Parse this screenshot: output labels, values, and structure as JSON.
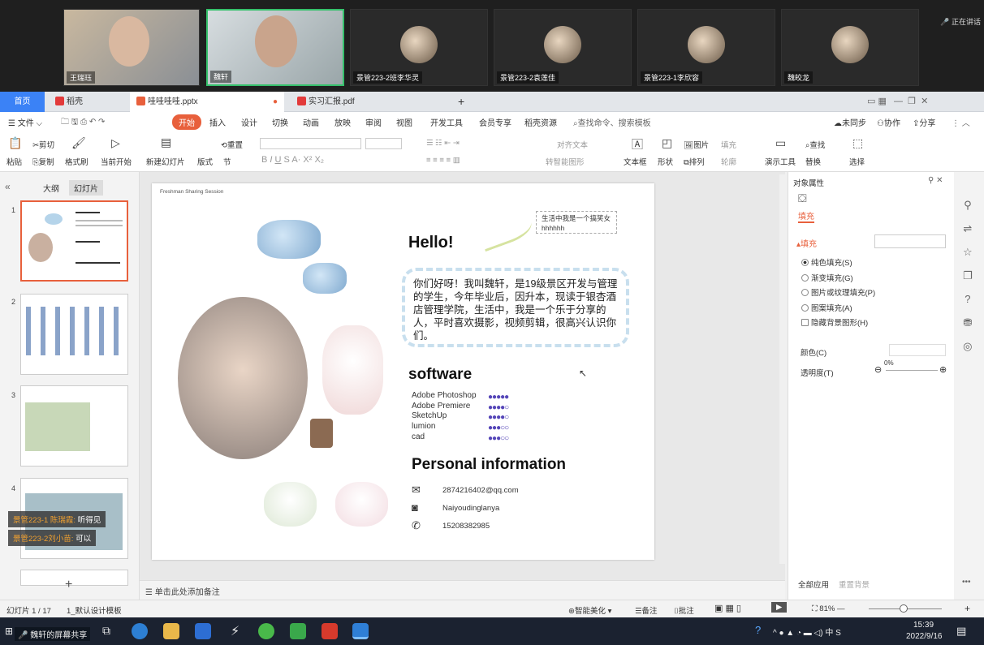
{
  "video": {
    "participants": [
      "王瑞珏",
      "魏轩",
      "景管223-2班李华灵",
      "景管223-2袁莲佳",
      "景管223-1李欣容",
      "魏皎龙"
    ],
    "speaking": "正在讲话"
  },
  "tabs": {
    "home": "首页",
    "daoke": "稻壳",
    "pptx": "哇哇哇哇.pptx",
    "pdf": "实习汇报.pdf",
    "add": "+"
  },
  "menu": {
    "file": "文件",
    "start": "开始",
    "insert": "插入",
    "design": "设计",
    "switch": "切换",
    "animation": "动画",
    "show": "放映",
    "review": "审阅",
    "view": "视图",
    "dev": "开发工具",
    "member": "会员专享",
    "resources": "稻壳资源",
    "search": "查找命令、搜索模板",
    "sync": "未同步",
    "collab": "协作",
    "share": "分享"
  },
  "ribbon": {
    "cut": "剪切",
    "copy": "复制",
    "format_brush": "格式刷",
    "paste": "粘贴",
    "from_current": "当前开始",
    "new_slide": "新建幻灯片",
    "layout": "版式",
    "section": "节",
    "reset": "重置",
    "textbox": "文本框",
    "shape": "形状",
    "picture": "图片",
    "fill": "填充",
    "arrange": "排列",
    "outline": "轮廓",
    "present_tool": "演示工具",
    "find": "查找",
    "replace": "替换",
    "select": "选择",
    "align_text": "对齐文本",
    "smart_shape": "转智能图形"
  },
  "left": {
    "outline_tab": "大纲",
    "slides_tab": "幻灯片",
    "nums": [
      "1",
      "2",
      "3",
      "4"
    ],
    "add": "+"
  },
  "chat": [
    {
      "name": "景管223-1 陈瑞霞:",
      "msg": "听得见"
    },
    {
      "name": "景管223-2刘小苗:",
      "msg": "可以"
    }
  ],
  "slide": {
    "header": "Freshman Sharing Session",
    "note": "生活中我是一个搞笑女 hhhhhh",
    "hello": "Hello!",
    "intro": "你们好呀！我叫魏轩，是19级景区开发与管理的学生，今年毕业后，因升本，现读于银杏酒店管理学院，生活中，我是一个乐于分享的人，平时喜欢摄影，视频剪辑，很高兴认识你们。",
    "software_title": "software",
    "software": [
      "Adobe Photoshop",
      "Adobe Premiere",
      "SketchUp",
      "lumion",
      "cad"
    ],
    "software_levels": [
      5,
      4,
      4,
      3,
      3
    ],
    "personal_title": "Personal information",
    "email": "2874216402@qq.com",
    "instagram": "Naiyoudinglanya",
    "phone": "15208382985"
  },
  "notes": "单击此处添加备注",
  "right": {
    "title": "对象属性",
    "tab": "填充",
    "section": "填充",
    "options": [
      "纯色填充(S)",
      "渐变填充(G)",
      "图片或纹理填充(P)",
      "图案填充(A)",
      "隐藏背景图形(H)"
    ],
    "color": "颜色(C)",
    "transparency": "透明度(T)",
    "transparency_val": "0%",
    "apply_all": "全部应用",
    "reset_bg": "重置背景"
  },
  "status": {
    "slide_count": "幻灯片 1 / 17",
    "template": "1_默认设计模板",
    "beautify": "智能美化",
    "notes": "备注",
    "comment": "批注",
    "zoom": "81%"
  },
  "taskbar": {
    "share": "魏轩的屏幕共享",
    "time": "15:39",
    "date": "2022/9/16",
    "ime": "中"
  },
  "colors": {
    "accent": "#e8603c",
    "home_tab": "#3b82f6",
    "dot": "#5546b8"
  }
}
